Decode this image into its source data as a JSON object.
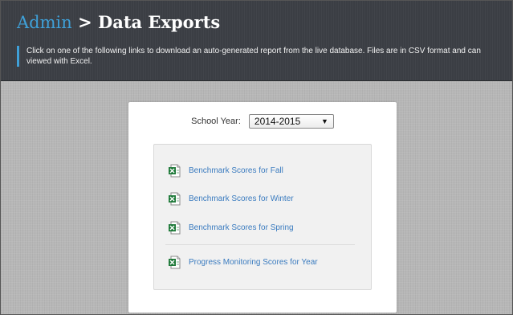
{
  "header": {
    "crumb": "Admin",
    "separator": ">",
    "title": "Data Exports",
    "description": "Click on one of the following links to download an auto-generated report from the live database. Files are in CSV format and can viewed with Excel."
  },
  "filter": {
    "label": "School Year:",
    "selected": "2014-2015",
    "arrow": "▼"
  },
  "links": [
    {
      "label": "Benchmark Scores for Fall",
      "icon": "excel-file-icon"
    },
    {
      "label": "Benchmark Scores for Winter",
      "icon": "excel-file-icon"
    },
    {
      "label": "Benchmark Scores for Spring",
      "icon": "excel-file-icon"
    },
    {
      "label": "Progress Monitoring Scores for Year",
      "icon": "excel-file-icon"
    }
  ],
  "colors": {
    "header_bg": "#3b3e44",
    "accent": "#3fa0d8",
    "link": "#3a7bbf",
    "excel_green": "#1f7a3a"
  }
}
